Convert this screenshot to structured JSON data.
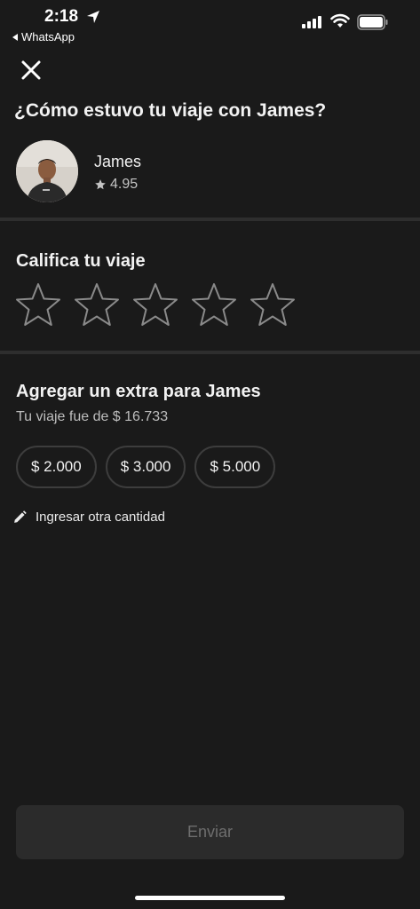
{
  "status_bar": {
    "time": "2:18",
    "back_app": "WhatsApp"
  },
  "header": {
    "title": "¿Cómo estuvo tu viaje con James?"
  },
  "driver": {
    "name": "James",
    "rating": "4.95"
  },
  "rate_section": {
    "title": "Califica tu viaje",
    "stars_total": 5,
    "stars_selected": 0
  },
  "tip_section": {
    "title": "Agregar un extra para James",
    "trip_note": "Tu viaje fue de $ 16.733",
    "options": [
      "$ 2.000",
      "$ 3.000",
      "$ 5.000"
    ],
    "custom_label": "Ingresar otra cantidad"
  },
  "footer": {
    "send_label": "Enviar"
  },
  "colors": {
    "background": "#1a1a1a",
    "divider": "#2e2e2e",
    "button_disabled_bg": "#2b2b2b",
    "button_disabled_text": "#6e6e6e"
  },
  "icons": {
    "close": "close-icon",
    "star_rating": "star-icon",
    "edit": "pencil-icon",
    "location": "location-arrow-icon"
  }
}
